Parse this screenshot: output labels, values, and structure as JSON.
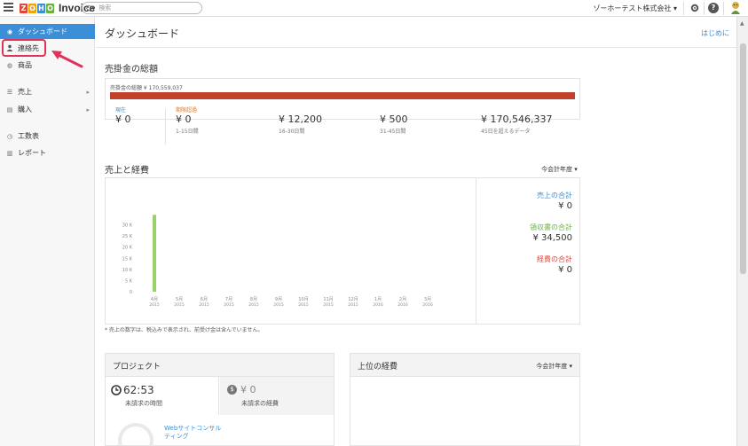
{
  "app": {
    "logo_letters": [
      {
        "t": "Z",
        "c": "#e3453b"
      },
      {
        "t": "O",
        "c": "#f0a30a"
      },
      {
        "t": "H",
        "c": "#3a8fd6"
      },
      {
        "t": "O",
        "c": "#69b33f"
      }
    ],
    "name": "Invoice",
    "search_prefix": "Q▾",
    "search_placeholder": "検索",
    "org_name": "ゾーホーテスト株式会社",
    "org_caret": "▾"
  },
  "sidebar": {
    "items": [
      {
        "label": "ダッシュボード",
        "icon": "dashboard-icon",
        "glyph": "◉"
      },
      {
        "label": "連絡先",
        "icon": "contact-icon",
        "glyph": "👤"
      },
      {
        "label": "商品",
        "icon": "items-icon",
        "glyph": "◍"
      },
      {
        "label": "売上",
        "icon": "sales-icon",
        "glyph": "☰",
        "chev": "▸"
      },
      {
        "label": "購入",
        "icon": "purchases-icon",
        "glyph": "▤",
        "chev": "▸"
      },
      {
        "label": "工数表",
        "icon": "timesheet-icon",
        "glyph": "◷"
      },
      {
        "label": "レポート",
        "icon": "reports-icon",
        "glyph": "▥"
      }
    ]
  },
  "main": {
    "title": "ダッシュボード",
    "start_link": "はじめに",
    "receivables": {
      "title": "売掛金の総額",
      "total_label": "売掛金の総額 ¥ 170,559,037",
      "cells": [
        {
          "label": "現在",
          "label_color": "#3a8fd6",
          "amount": "¥ 0",
          "sub": ""
        },
        {
          "label": "期限超過",
          "label_color": "#e07a24",
          "amount": "¥ 0",
          "sub": "1-15日間"
        },
        {
          "label": "",
          "label_color": "#333",
          "amount": "¥ 12,200",
          "sub": "16-30日間"
        },
        {
          "label": "",
          "label_color": "#333",
          "amount": "¥ 500",
          "sub": "31-45日間"
        },
        {
          "label": "",
          "label_color": "#333",
          "amount": "¥ 170,546,337",
          "sub": "45日を超えるデータ"
        }
      ]
    },
    "sales_expenses": {
      "title": "売上と経費",
      "period": "今会計年度",
      "caret": "▾",
      "summaries": [
        {
          "label": "売上の合計",
          "color": "#3a8fd6",
          "value": "¥ 0"
        },
        {
          "label": "領収書の合計",
          "color": "#69b33f",
          "value": "¥ 34,500"
        },
        {
          "label": "経費の合計",
          "color": "#e3453b",
          "value": "¥ 0"
        }
      ],
      "footnote": "* 売上の数字は、税込みで表示され、前受け金は含んでいません。"
    },
    "projects": {
      "title": "プロジェクト",
      "hours": "62:53",
      "hours_label": "未請求の時間",
      "expense": "¥ 0",
      "expense_label": "未請求の経費",
      "project_name": "Webサイトコンサルティング"
    },
    "top_expenses": {
      "title": "上位の経費",
      "period": "今会計年度",
      "caret": "▾"
    }
  },
  "chart_data": {
    "type": "bar",
    "categories": [
      "4月\n2015",
      "5月\n2015",
      "6月\n2015",
      "7月\n2015",
      "8月\n2015",
      "9月\n2015",
      "10月\n2015",
      "11月\n2015",
      "12月\n2015",
      "1月\n2016",
      "2月\n2016",
      "3月\n2016"
    ],
    "category_labels": [
      {
        "m": "4月",
        "y": "2015"
      },
      {
        "m": "5月",
        "y": "2015"
      },
      {
        "m": "6月",
        "y": "2015"
      },
      {
        "m": "7月",
        "y": "2015"
      },
      {
        "m": "8月",
        "y": "2015"
      },
      {
        "m": "9月",
        "y": "2015"
      },
      {
        "m": "10月",
        "y": "2015"
      },
      {
        "m": "11月",
        "y": "2015"
      },
      {
        "m": "12月",
        "y": "2015"
      },
      {
        "m": "1月",
        "y": "2016"
      },
      {
        "m": "2月",
        "y": "2016"
      },
      {
        "m": "3月",
        "y": "2016"
      }
    ],
    "series": [
      {
        "color": "#9ad26a",
        "values": [
          34500,
          0,
          0,
          0,
          0,
          0,
          0,
          0,
          0,
          0,
          0,
          0
        ]
      }
    ],
    "yticks": [
      "0",
      "5 K",
      "10 K",
      "15 K",
      "20 K",
      "25 K",
      "30 K"
    ],
    "ylim": [
      0,
      35000
    ],
    "grid": false
  }
}
